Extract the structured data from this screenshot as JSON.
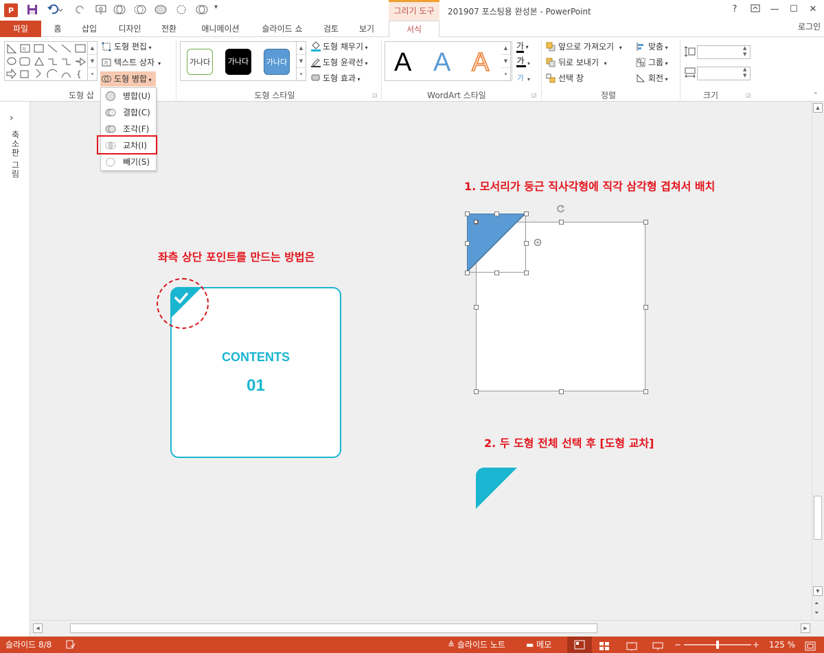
{
  "title_bar": {
    "context_tab": "그리기 도구",
    "document_title": "201907 포스팅용 완성본 - PowerPoint",
    "help": "?",
    "minimize": "—",
    "maximize": "☐",
    "close": "✕"
  },
  "tabs": {
    "file": "파일",
    "items": [
      "홈",
      "삽입",
      "디자인",
      "전환",
      "애니메이션",
      "슬라이드 쇼",
      "검토",
      "보기"
    ],
    "active": "서식",
    "login": "로그인"
  },
  "ribbon": {
    "insert_shapes": {
      "label": "도형 삽입",
      "edit_shape": "도형 편집",
      "text_box": "텍스트 상자",
      "merge_shapes": "도형 병합"
    },
    "shape_styles": {
      "label": "도형 스타일",
      "thumb_text": "가나다",
      "fill": "도형 채우기",
      "outline": "도형 윤곽선",
      "effects": "도형 효과"
    },
    "wordart": {
      "label": "WordArt 스타일",
      "letter": "A",
      "text_fill_glyph": "가"
    },
    "arrange": {
      "label": "정렬",
      "bring_forward": "앞으로 가져오기",
      "send_backward": "뒤로 보내기",
      "selection_pane": "선택 창",
      "align": "맞춤",
      "group": "그룹",
      "rotate": "회전"
    },
    "size": {
      "label": "크기"
    }
  },
  "merge_menu": {
    "items": [
      "병합(U)",
      "결합(C)",
      "조각(F)",
      "교차(I)",
      "빼기(S)"
    ],
    "highlighted": "교차(I)"
  },
  "side_pane": {
    "label": "축소판 그림",
    "expand": "›"
  },
  "slide": {
    "note_left": "좌측 상단 포인트를 만드는 방법은",
    "card_title": "CONTENTS",
    "card_number": "01",
    "step1": "1. 모서리가 둥근 직사각형에 직각 삼각형 겹쳐서 배치",
    "step2": "2. 두 도형 전체 선택 후 [도형 교차]"
  },
  "colors": {
    "accent_orange": "#d24726",
    "teal": "#1ab5d0",
    "triangle_blue": "#5b9bd5",
    "annotation_red": "#e3141c"
  },
  "status_bar": {
    "slide_count": "슬라이드 8/8",
    "notes": "슬라이드 노트",
    "comments": "메모",
    "zoom": "125 %"
  }
}
